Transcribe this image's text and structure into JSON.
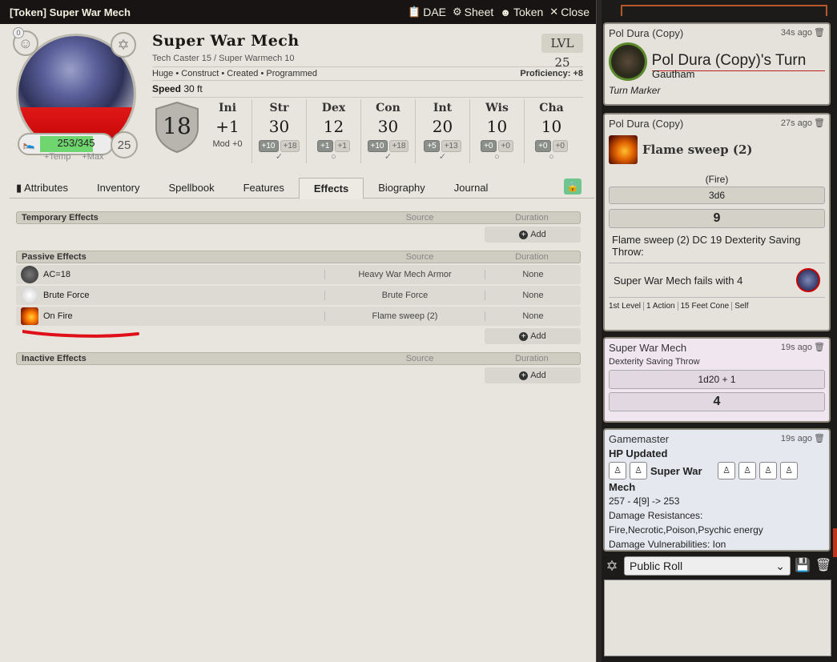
{
  "sheet": {
    "window_title": "[Token] Super War Mech",
    "header_buttons": [
      {
        "icon": "clipboard-icon",
        "label": "DAE"
      },
      {
        "icon": "gear-icon",
        "label": "Sheet"
      },
      {
        "icon": "user-circle-icon",
        "label": "Token"
      },
      {
        "icon": "close-icon",
        "label": "Close"
      }
    ],
    "name": "Super War Mech",
    "subtitle": "Tech Caster 15 / Super Warmech 10",
    "level": "LVL 25",
    "traits": "Huge • Construct • Created • Programmed",
    "proficiency": "Proficiency: +8",
    "speed_label": "Speed",
    "speed_value": "30 ft",
    "inspiration_count": "0",
    "hp": {
      "value": "253",
      "max": "345",
      "display": "253/345",
      "fraction": 0.733,
      "temp_label": "+Temp",
      "max_label": "+Max"
    },
    "hit_dice": "25",
    "ac": "18",
    "initiative": {
      "label": "Ini",
      "value": "+1",
      "mod": "Mod +0"
    },
    "abilities": [
      {
        "label": "Str",
        "score": "30",
        "mod": "+10",
        "save": "+18",
        "proficient": true
      },
      {
        "label": "Dex",
        "score": "12",
        "mod": "+1",
        "save": "+1",
        "proficient": false
      },
      {
        "label": "Con",
        "score": "30",
        "mod": "+10",
        "save": "+18",
        "proficient": true
      },
      {
        "label": "Int",
        "score": "20",
        "mod": "+5",
        "save": "+13",
        "proficient": true
      },
      {
        "label": "Wis",
        "score": "10",
        "mod": "+0",
        "save": "+0",
        "proficient": false
      },
      {
        "label": "Cha",
        "score": "10",
        "mod": "+0",
        "save": "+0",
        "proficient": false
      }
    ],
    "tabs": [
      "Attributes",
      "Inventory",
      "Spellbook",
      "Features",
      "Effects",
      "Biography",
      "Journal"
    ],
    "active_tab": "Effects",
    "effects": {
      "columns": {
        "source": "Source",
        "duration": "Duration"
      },
      "add_label": "Add",
      "temporary": {
        "title": "Temporary Effects",
        "rows": []
      },
      "passive": {
        "title": "Passive Effects",
        "rows": [
          {
            "icon": "shield-icon",
            "name": "AC=18",
            "source": "Heavy War Mech Armor",
            "duration": "None"
          },
          {
            "icon": "fist-icon",
            "name": "Brute Force",
            "source": "Brute Force",
            "duration": "None"
          },
          {
            "icon": "fire-icon",
            "name": "On Fire",
            "source": "Flame sweep (2)",
            "duration": "None"
          }
        ]
      },
      "inactive": {
        "title": "Inactive Effects",
        "rows": []
      }
    }
  },
  "chat": {
    "messages": [
      {
        "speaker": "Pol Dura (Copy)",
        "time": "34s ago",
        "turn_title": "Pol Dura (Copy)'s Turn",
        "actor": "Gautham",
        "flavor": "Turn Marker"
      },
      {
        "speaker": "Pol Dura (Copy)",
        "time": "27s ago",
        "item_name": "Flame sweep (2)",
        "damage_type": "(Fire)",
        "formula": "3d6",
        "total": "9",
        "save_text": "Flame sweep (2) DC 19 Dexterity Saving Throw:",
        "fail_text": "Super War Mech fails with 4",
        "tags": [
          "1st Level",
          "1 Action",
          "15 Feet Cone",
          "Self"
        ]
      },
      {
        "speaker": "Super War Mech",
        "time": "19s ago",
        "flavor": "Dexterity Saving Throw",
        "formula": "1d20 + 1",
        "total": "4"
      },
      {
        "speaker": "Gamemaster",
        "time": "19s ago",
        "title": "HP Updated",
        "target_first": "Super War",
        "target_second": "Mech",
        "hp_change": "257 - 4[9] -> 253",
        "resist_label": "Damage Resistances:",
        "resist_value": "Fire,Necrotic,Poison,Psychic energy",
        "vuln": "Damage Vulnerabilities: Ion"
      }
    ],
    "roll_mode": "Public Roll"
  },
  "colors": {
    "hp_fill": "#6fd66f",
    "lock_green": "#6fc58e",
    "annotation_red": "#e0101a",
    "whisper_pink": "#f0e6f0"
  }
}
